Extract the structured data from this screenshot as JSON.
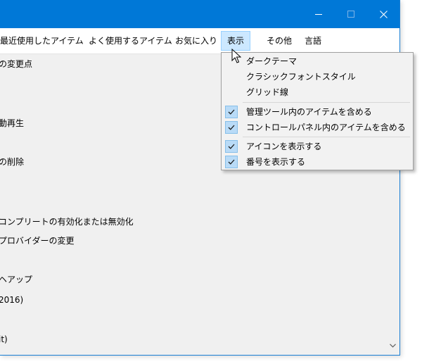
{
  "titlebar": {
    "controls": [
      {
        "icon": "minimize-icon"
      },
      {
        "icon": "maximize-icon"
      },
      {
        "icon": "close-icon"
      }
    ]
  },
  "menubar": {
    "items": [
      {
        "label": "最近使用したアイテム"
      },
      {
        "label": "よく使用するアイテム"
      },
      {
        "label": "お気に入り"
      },
      {
        "label": "表示",
        "active": true
      },
      {
        "label": "その他"
      },
      {
        "label": "言語"
      }
    ]
  },
  "list": {
    "items": [
      {
        "label": "の変更点"
      },
      {
        "label": "動再生"
      },
      {
        "label": "の削除"
      },
      {
        "label": "コンプリートの有効化または無効化"
      },
      {
        "label": "プロバイダーの変更"
      },
      {
        "label": "ヘアップ"
      },
      {
        "label": "2016)"
      },
      {
        "label": "it)"
      }
    ]
  },
  "view_menu": {
    "items": [
      {
        "label": "ダークテーマ",
        "checked": false
      },
      {
        "label": "クラシックフォントスタイル",
        "checked": false
      },
      {
        "label": "グリッド線",
        "checked": false
      },
      {
        "label": "管理ツール内のアイテムを含める",
        "checked": true
      },
      {
        "label": "コントロールパネル内のアイテムを含める",
        "checked": true
      },
      {
        "label": "アイコンを表示する",
        "checked": true
      },
      {
        "label": "番号を表示する",
        "checked": true
      }
    ]
  },
  "colors": {
    "titlebar": "#0078d7",
    "menu_active_bg": "#cce8ff",
    "menu_active_border": "#99d1ff",
    "check_bg": "#b9dbf7"
  }
}
